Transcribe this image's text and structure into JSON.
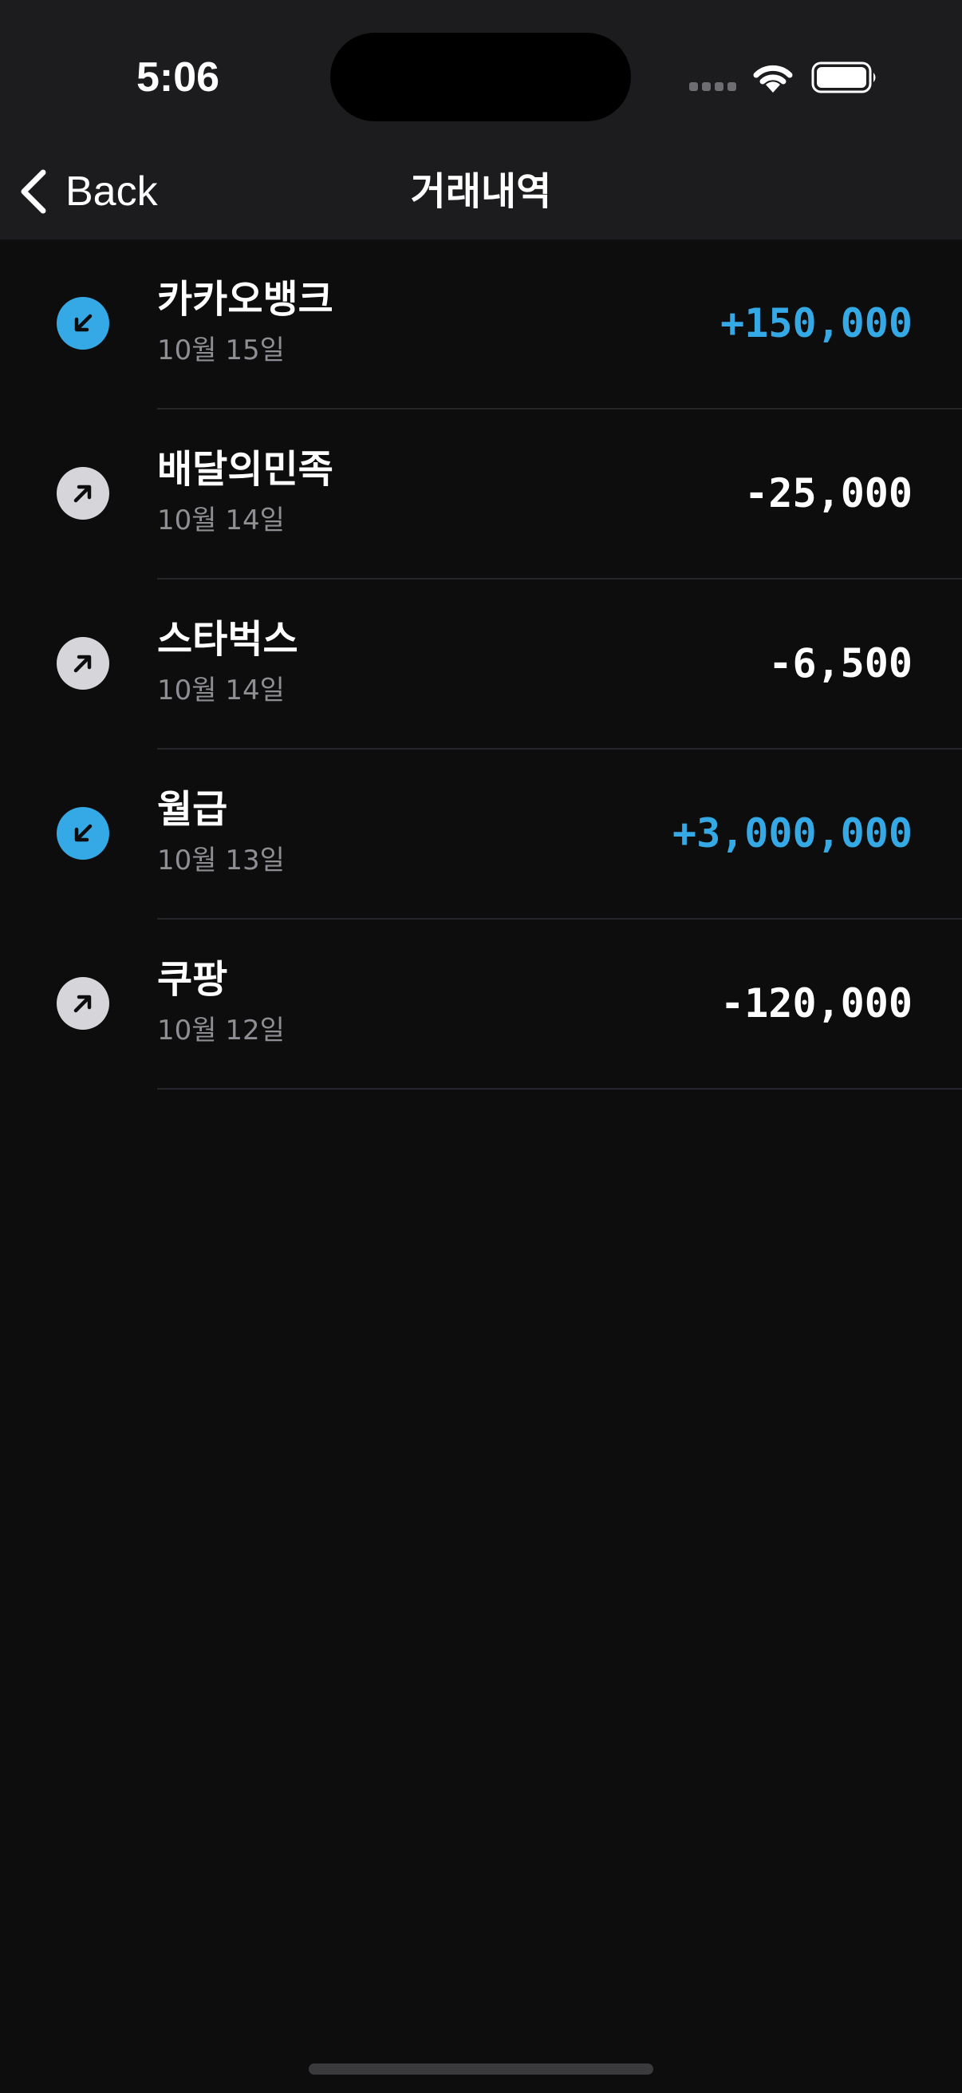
{
  "status_bar": {
    "time": "5:06"
  },
  "nav": {
    "back_label": "Back",
    "title": "거래내역"
  },
  "transactions": [
    {
      "name": "카카오뱅크",
      "date": "10월 15일",
      "amount": "+150,000",
      "direction": "incoming"
    },
    {
      "name": "배달의민족",
      "date": "10월 14일",
      "amount": "-25,000",
      "direction": "outgoing"
    },
    {
      "name": "스타벅스",
      "date": "10월 14일",
      "amount": "-6,500",
      "direction": "outgoing"
    },
    {
      "name": "월급",
      "date": "10월 13일",
      "amount": "+3,000,000",
      "direction": "incoming"
    },
    {
      "name": "쿠팡",
      "date": "10월 12일",
      "amount": "-120,000",
      "direction": "outgoing"
    }
  ],
  "icons": {
    "incoming": "arrow-down-left-icon",
    "outgoing": "arrow-up-right-icon",
    "back": "chevron-left-icon"
  },
  "colors": {
    "background": "#0d0d0e",
    "header_background": "#1c1c1f",
    "incoming_accent": "#35a9e6",
    "outgoing_icon_bg": "#d6d6da",
    "secondary_text": "#8e8e93",
    "divider": "#26262a"
  }
}
